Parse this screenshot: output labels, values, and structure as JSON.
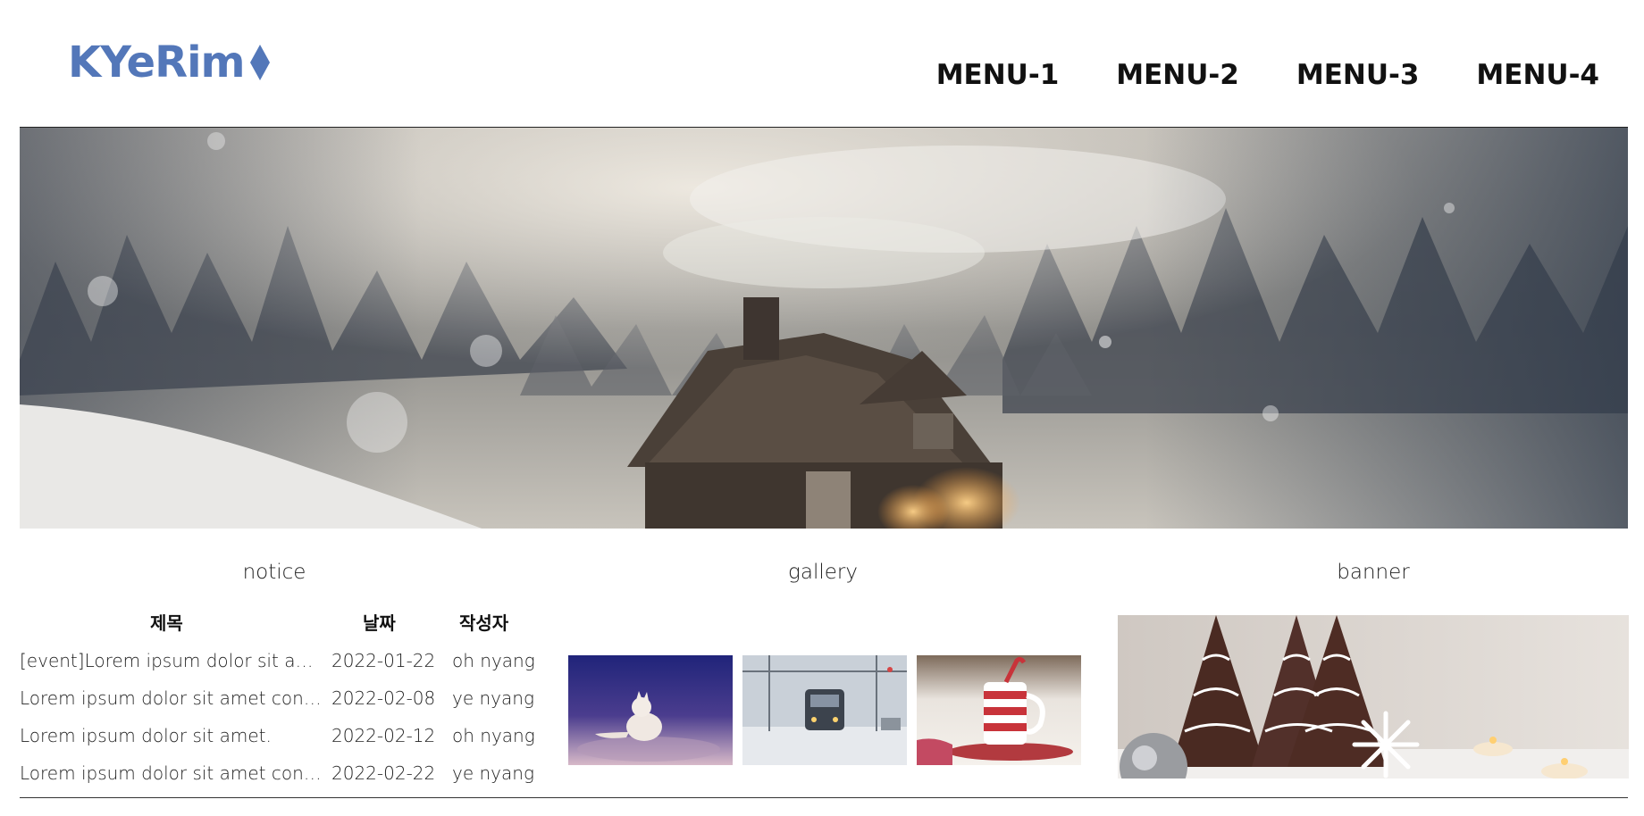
{
  "header": {
    "logo_text": "KYeRim",
    "logo_color": "#5377b9",
    "nav": [
      {
        "label": "MENU-1"
      },
      {
        "label": "MENU-2"
      },
      {
        "label": "MENU-3"
      },
      {
        "label": "MENU-4"
      }
    ]
  },
  "hero": {
    "image": "snowy-cabin-forest-image"
  },
  "notice": {
    "title": "notice",
    "columns": {
      "title": "제목",
      "date": "날짜",
      "author": "작성자"
    },
    "rows": [
      {
        "title": "[event]Lorem ipsum dolor sit amet.",
        "date": "2022-01-22",
        "author": "oh nyang"
      },
      {
        "title": "Lorem ipsum dolor sit amet consectetur",
        "date": "2022-02-08",
        "author": "ye nyang"
      },
      {
        "title": "Lorem ipsum dolor sit amet.",
        "date": "2022-02-12",
        "author": "oh nyang"
      },
      {
        "title": "Lorem ipsum dolor sit amet consectetur",
        "date": "2022-02-22",
        "author": "ye nyang"
      }
    ]
  },
  "gallery": {
    "title": "gallery",
    "images": [
      "arctic-fox-image",
      "snowy-train-image",
      "hot-cocoa-mug-image"
    ]
  },
  "banner": {
    "title": "banner",
    "image": "christmas-cookie-trees-image"
  }
}
